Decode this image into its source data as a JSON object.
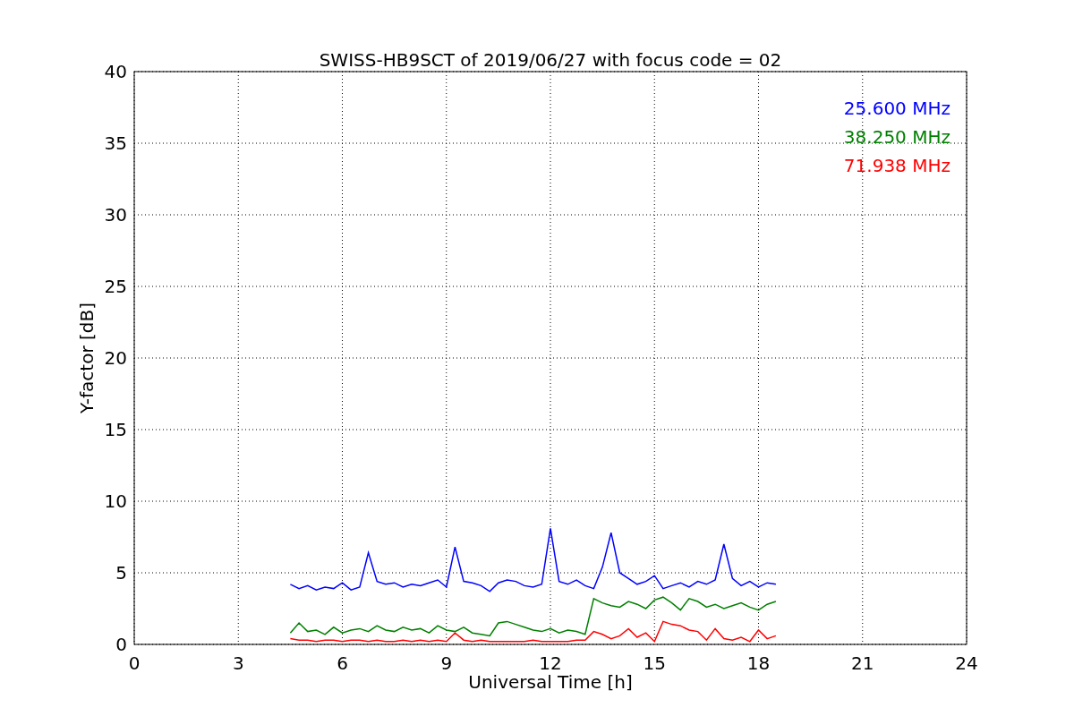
{
  "figure": {
    "chart_data": {
      "type": "line",
      "title": "SWISS-HB9SCT of 2019/06/27 with focus code = 02",
      "xlabel": "Universal Time [h]",
      "ylabel": "Y-factor [dB]",
      "x": [
        4.5,
        4.75,
        5,
        5.25,
        5.5,
        5.75,
        6,
        6.25,
        6.5,
        6.75,
        7,
        7.25,
        7.5,
        7.75,
        8,
        8.25,
        8.5,
        8.75,
        9,
        9.25,
        9.5,
        9.75,
        10,
        10.25,
        10.5,
        10.75,
        11,
        11.25,
        11.5,
        11.75,
        12,
        12.25,
        12.5,
        12.75,
        13,
        13.25,
        13.5,
        13.75,
        14,
        14.25,
        14.5,
        14.75,
        15,
        15.25,
        15.5,
        15.75,
        16,
        16.25,
        16.5,
        16.75,
        17,
        17.25,
        17.5,
        17.75,
        18,
        18.25,
        18.5
      ],
      "series": [
        {
          "name": "25.600 MHz",
          "color": "#0000ff",
          "values": [
            4.2,
            3.9,
            4.1,
            3.8,
            4.0,
            3.9,
            4.3,
            3.8,
            4.0,
            6.4,
            4.4,
            4.2,
            4.3,
            4.0,
            4.2,
            4.1,
            4.3,
            4.5,
            4.0,
            6.8,
            4.4,
            4.3,
            4.1,
            3.7,
            4.3,
            4.5,
            4.4,
            4.1,
            4.0,
            4.2,
            8.1,
            4.4,
            4.2,
            4.5,
            4.1,
            3.9,
            5.4,
            7.8,
            5.0,
            4.6,
            4.2,
            4.4,
            4.8,
            3.9,
            4.1,
            4.3,
            4.0,
            4.4,
            4.2,
            4.5,
            7.0,
            4.6,
            4.1,
            4.4,
            4.0,
            4.3,
            4.2
          ]
        },
        {
          "name": "38.250 MHz",
          "color": "#008000",
          "values": [
            0.8,
            1.5,
            0.9,
            1.0,
            0.7,
            1.2,
            0.8,
            1.0,
            1.1,
            0.9,
            1.3,
            1.0,
            0.9,
            1.2,
            1.0,
            1.1,
            0.8,
            1.3,
            1.0,
            0.9,
            1.2,
            0.8,
            0.7,
            0.6,
            1.5,
            1.6,
            1.4,
            1.2,
            1.0,
            0.9,
            1.1,
            0.8,
            1.0,
            0.9,
            0.7,
            3.2,
            2.9,
            2.7,
            2.6,
            3.0,
            2.8,
            2.5,
            3.1,
            3.3,
            2.9,
            2.4,
            3.2,
            3.0,
            2.6,
            2.8,
            2.5,
            2.7,
            2.9,
            2.6,
            2.4,
            2.8,
            3.0
          ]
        },
        {
          "name": "71.938 MHz",
          "color": "#ff0000",
          "values": [
            0.4,
            0.3,
            0.3,
            0.2,
            0.3,
            0.3,
            0.2,
            0.3,
            0.3,
            0.2,
            0.3,
            0.2,
            0.2,
            0.3,
            0.2,
            0.3,
            0.2,
            0.3,
            0.2,
            0.8,
            0.3,
            0.2,
            0.3,
            0.2,
            0.2,
            0.2,
            0.2,
            0.2,
            0.3,
            0.2,
            0.2,
            0.2,
            0.2,
            0.3,
            0.3,
            0.9,
            0.7,
            0.4,
            0.6,
            1.1,
            0.5,
            0.8,
            0.2,
            1.6,
            1.4,
            1.3,
            1.0,
            0.9,
            0.3,
            1.1,
            0.4,
            0.3,
            0.5,
            0.2,
            1.0,
            0.4,
            0.6
          ]
        }
      ],
      "grid": true,
      "xlim": [
        0,
        24
      ],
      "ylim": [
        0,
        40
      ],
      "xticks": [
        0,
        3,
        6,
        9,
        12,
        15,
        18,
        21,
        24
      ],
      "yticks": [
        0,
        5,
        10,
        15,
        20,
        25,
        30,
        35,
        40
      ]
    }
  }
}
